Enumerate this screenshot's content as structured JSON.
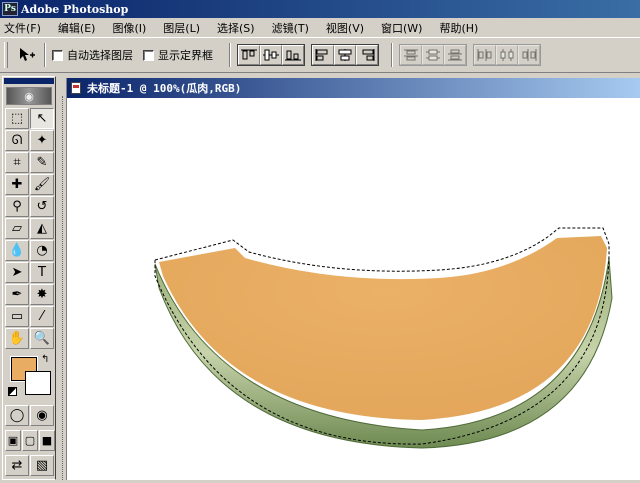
{
  "app": {
    "title": "Adobe Photoshop",
    "icon": "photoshop-icon"
  },
  "menu": [
    "文件(F)",
    "编辑(E)",
    "图像(I)",
    "图层(L)",
    "选择(S)",
    "滤镜(T)",
    "视图(V)",
    "窗口(W)",
    "帮助(H)"
  ],
  "options": {
    "tool_icon": "move-tool-icon",
    "auto_select_label": "自动选择图层",
    "auto_select_checked": false,
    "show_bounding_label": "显示定界框",
    "show_bounding_checked": false
  },
  "document": {
    "title": "未标题-1 @ 100%(瓜肉,RGB)"
  },
  "toolbox": {
    "tools": [
      {
        "name": "marquee-tool-icon",
        "glyph": "⬚"
      },
      {
        "name": "move-tool-icon",
        "glyph": "↖",
        "active": true
      },
      {
        "name": "lasso-tool-icon",
        "glyph": "ᘏ"
      },
      {
        "name": "magic-wand-tool-icon",
        "glyph": "✦"
      },
      {
        "name": "crop-tool-icon",
        "glyph": "⌗"
      },
      {
        "name": "slice-tool-icon",
        "glyph": "✎"
      },
      {
        "name": "healing-brush-icon",
        "glyph": "✚"
      },
      {
        "name": "brush-tool-icon",
        "glyph": "🖌"
      },
      {
        "name": "clone-stamp-icon",
        "glyph": "⚲"
      },
      {
        "name": "history-brush-icon",
        "glyph": "↺"
      },
      {
        "name": "eraser-tool-icon",
        "glyph": "▱"
      },
      {
        "name": "paint-bucket-icon",
        "glyph": "◭"
      },
      {
        "name": "blur-tool-icon",
        "glyph": "💧"
      },
      {
        "name": "dodge-tool-icon",
        "glyph": "◔"
      },
      {
        "name": "path-select-icon",
        "glyph": "➤"
      },
      {
        "name": "type-tool-icon",
        "glyph": "T"
      },
      {
        "name": "pen-tool-icon",
        "glyph": "✒"
      },
      {
        "name": "custom-shape-icon",
        "glyph": "✸"
      },
      {
        "name": "notes-tool-icon",
        "glyph": "▭"
      },
      {
        "name": "eyedropper-tool-icon",
        "glyph": "⁄"
      },
      {
        "name": "hand-tool-icon",
        "glyph": "✋"
      },
      {
        "name": "zoom-tool-icon",
        "glyph": "🔍"
      }
    ],
    "foreground_color": "#e8ad63",
    "background_color": "#ffffff",
    "modes": [
      {
        "name": "standard-mode-icon",
        "glyph": "◯"
      },
      {
        "name": "quick-mask-mode-icon",
        "glyph": "◉"
      }
    ],
    "screen_modes": [
      {
        "name": "screen-mode-standard-icon",
        "glyph": "▣"
      },
      {
        "name": "screen-mode-full-menu-icon",
        "glyph": "▢"
      },
      {
        "name": "screen-mode-full-icon",
        "glyph": "■"
      }
    ],
    "jump_to": [
      {
        "name": "jump-to-imageready-icon",
        "glyph": "⇄"
      },
      {
        "name": "jump-to-other-icon",
        "glyph": "▧"
      }
    ]
  },
  "colors": {
    "flesh": "#e8ad63",
    "rind_light": "#b9c99a",
    "rind_dark": "#5d7a45",
    "selection": "#000000"
  }
}
